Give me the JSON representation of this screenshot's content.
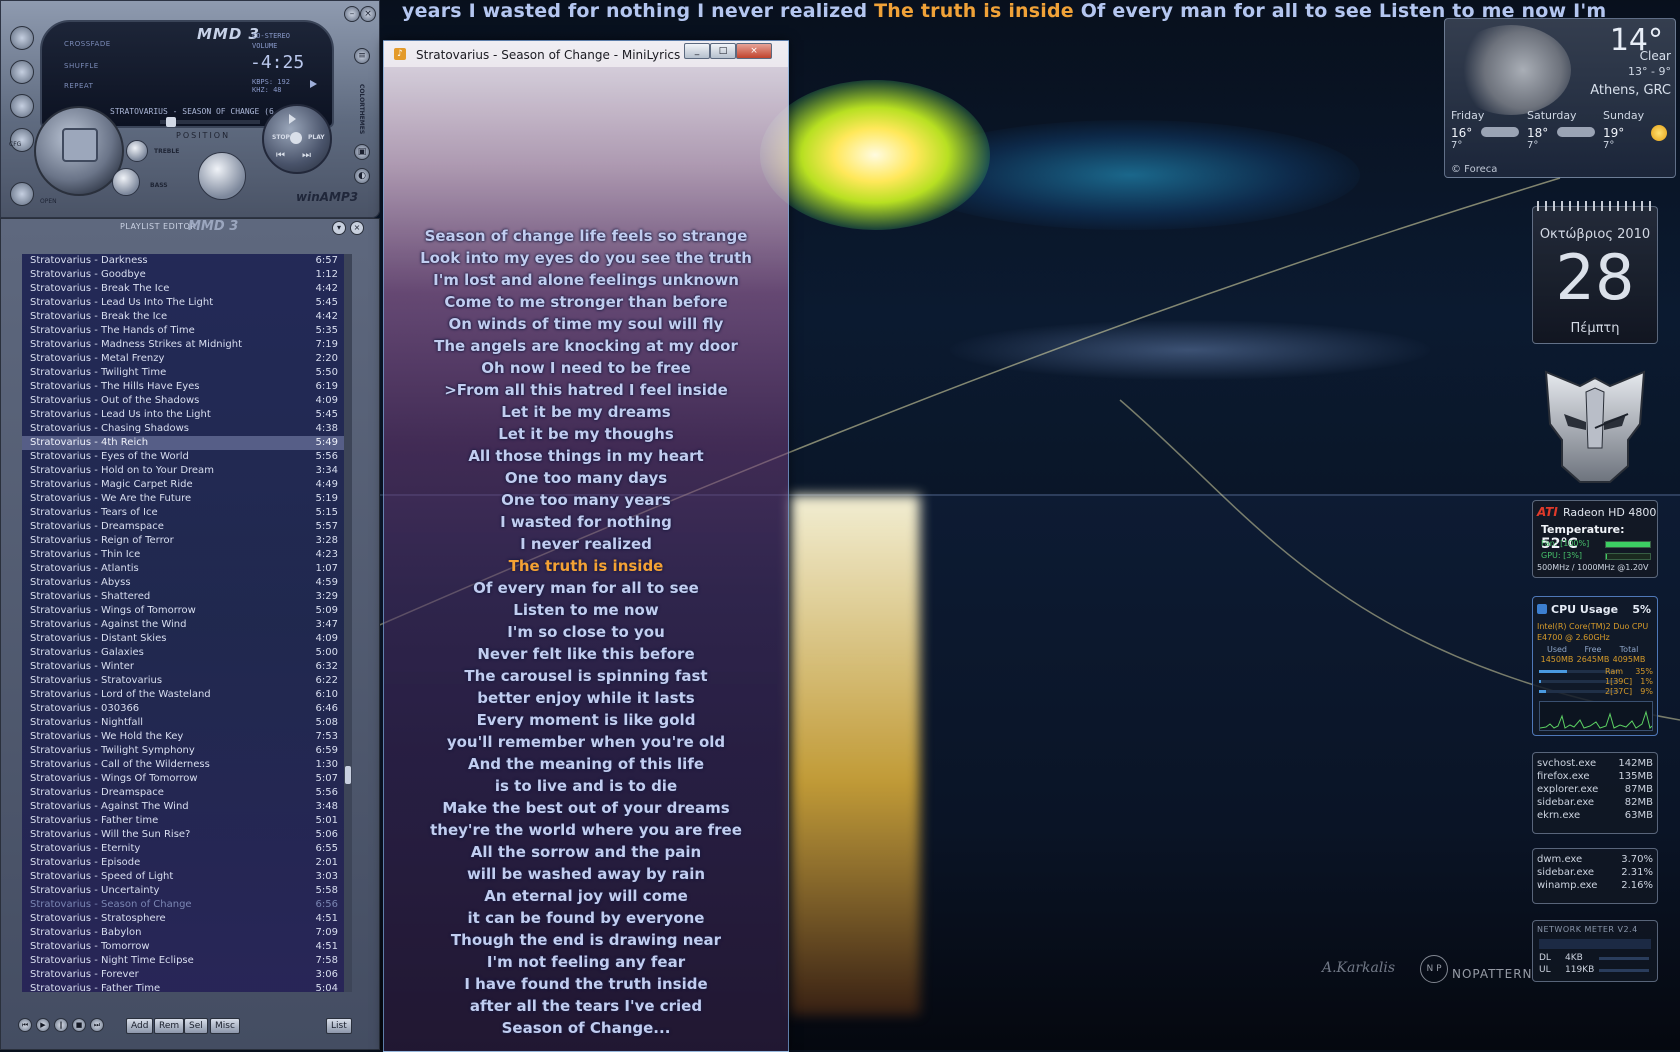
{
  "ticker": {
    "before": "years  I wasted for nothing  I never realized  ",
    "current": "The truth is inside",
    "after": "  Of every man for all to see  Listen to me now  I'm"
  },
  "winamp": {
    "logo": "MMD 3",
    "options": [
      "CROSSFADE",
      "SHUFFLE",
      "REPEAT"
    ],
    "stereo": "CO-STEREO",
    "volume": "VOLUME",
    "time": "-4:25",
    "kbps": "KBPS: 192",
    "khz": "KHZ: 48",
    "title": "STRATOVARIUS - SEASON OF CHANGE (6",
    "position_label": "POSITION",
    "stop_label": "STOP",
    "play_label": "PLAY",
    "treble_label": "TREBLE",
    "bass_label": "BASS",
    "open_label": "OPEN",
    "brand": "winAMP3",
    "colorthemes": "COLORTHEMES",
    "cfg": "CFG"
  },
  "playlist": {
    "title": "PLAYLIST EDITOR",
    "mmd": "MMD 3",
    "tracks": [
      {
        "name": "Stratovarius - Darkness",
        "time": "6:57"
      },
      {
        "name": "Stratovarius - Goodbye",
        "time": "1:12"
      },
      {
        "name": "Stratovarius - Break The Ice",
        "time": "4:42"
      },
      {
        "name": "Stratovarius - Lead Us Into The Light",
        "time": "5:45"
      },
      {
        "name": "Stratovarius - Break the Ice",
        "time": "4:42"
      },
      {
        "name": "Stratovarius - The Hands of Time",
        "time": "5:35"
      },
      {
        "name": "Stratovarius - Madness Strikes at Midnight",
        "time": "7:19"
      },
      {
        "name": "Stratovarius - Metal Frenzy",
        "time": "2:20"
      },
      {
        "name": "Stratovarius - Twilight Time",
        "time": "5:50"
      },
      {
        "name": "Stratovarius - The Hills Have Eyes",
        "time": "6:19"
      },
      {
        "name": "Stratovarius - Out of the Shadows",
        "time": "4:09"
      },
      {
        "name": "Stratovarius - Lead Us into the Light",
        "time": "5:45"
      },
      {
        "name": "Stratovarius - Chasing Shadows",
        "time": "4:38"
      },
      {
        "name": "Stratovarius - 4th Reich",
        "time": "5:49"
      },
      {
        "name": "Stratovarius - Eyes of the World",
        "time": "5:56"
      },
      {
        "name": "Stratovarius - Hold on to Your Dream",
        "time": "3:34"
      },
      {
        "name": "Stratovarius - Magic Carpet Ride",
        "time": "4:49"
      },
      {
        "name": "Stratovarius - We Are the Future",
        "time": "5:19"
      },
      {
        "name": "Stratovarius - Tears of Ice",
        "time": "5:15"
      },
      {
        "name": "Stratovarius - Dreamspace",
        "time": "5:57"
      },
      {
        "name": "Stratovarius - Reign of Terror",
        "time": "3:28"
      },
      {
        "name": "Stratovarius - Thin Ice",
        "time": "4:23"
      },
      {
        "name": "Stratovarius - Atlantis",
        "time": "1:07"
      },
      {
        "name": "Stratovarius - Abyss",
        "time": "4:59"
      },
      {
        "name": "Stratovarius - Shattered",
        "time": "3:29"
      },
      {
        "name": "Stratovarius - Wings of Tomorrow",
        "time": "5:09"
      },
      {
        "name": "Stratovarius - Against the Wind",
        "time": "3:47"
      },
      {
        "name": "Stratovarius - Distant Skies",
        "time": "4:09"
      },
      {
        "name": "Stratovarius - Galaxies",
        "time": "5:00"
      },
      {
        "name": "Stratovarius - Winter",
        "time": "6:32"
      },
      {
        "name": "Stratovarius - Stratovarius",
        "time": "6:22"
      },
      {
        "name": "Stratovarius - Lord of the Wasteland",
        "time": "6:10"
      },
      {
        "name": "Stratovarius - 030366",
        "time": "6:46"
      },
      {
        "name": "Stratovarius - Nightfall",
        "time": "5:08"
      },
      {
        "name": "Stratovarius - We Hold the Key",
        "time": "7:53"
      },
      {
        "name": "Stratovarius - Twilight Symphony",
        "time": "6:59"
      },
      {
        "name": "Stratovarius - Call of the Wilderness",
        "time": "1:30"
      },
      {
        "name": "Stratovarius - Wings Of Tomorrow",
        "time": "5:07"
      },
      {
        "name": "Stratovarius - Dreamspace",
        "time": "5:56"
      },
      {
        "name": "Stratovarius - Against The Wind",
        "time": "3:48"
      },
      {
        "name": "Stratovarius - Father time",
        "time": "5:01"
      },
      {
        "name": "Stratovarius - Will the Sun Rise?",
        "time": "5:06"
      },
      {
        "name": "Stratovarius - Eternity",
        "time": "6:55"
      },
      {
        "name": "Stratovarius - Episode",
        "time": "2:01"
      },
      {
        "name": "Stratovarius - Speed of Light",
        "time": "3:03"
      },
      {
        "name": "Stratovarius - Uncertainty",
        "time": "5:58"
      },
      {
        "name": "Stratovarius - Season of Change",
        "time": "6:56"
      },
      {
        "name": "Stratovarius - Stratosphere",
        "time": "4:51"
      },
      {
        "name": "Stratovarius - Babylon",
        "time": "7:09"
      },
      {
        "name": "Stratovarius - Tomorrow",
        "time": "4:51"
      },
      {
        "name": "Stratovarius - Night Time Eclipse",
        "time": "7:58"
      },
      {
        "name": "Stratovarius - Forever",
        "time": "3:06"
      },
      {
        "name": "Stratovarius - Father Time",
        "time": "5:04"
      }
    ],
    "selected_index": 13,
    "playing_index": 46,
    "buttons": {
      "add": "Add",
      "rem": "Rem",
      "sel": "Sel",
      "misc": "Misc",
      "list": "List"
    }
  },
  "minilyrics": {
    "title": "Stratovarius - Season of Change - MiniLyrics",
    "current_index": 15,
    "lines": [
      "Season of change life feels so strange",
      "Look into my eyes do you see the truth",
      "I'm lost and alone feelings unknown",
      "Come to me stronger than before",
      "On winds of time my soul will fly",
      "The angels are knocking at my door",
      "Oh now I need to be free",
      ">From all this hatred I feel inside",
      "Let it be my dreams",
      "Let it be my thoughs",
      "All those things in my heart",
      "One too many days",
      "One too many years",
      "I wasted for nothing",
      "I never realized",
      "The truth is inside",
      "Of every man for all to see",
      "Listen to me now",
      "I'm so close to you",
      "Never felt like this before",
      "The carousel is spinning fast",
      "better enjoy while it lasts",
      "Every moment is like gold",
      "you'll remember when you're old",
      "And the meaning of this life",
      "is to live and is to die",
      "Make the best out of your dreams",
      "they're the world where you are free",
      "All the sorrow and the pain",
      "will be washed away by rain",
      "An eternal joy will come",
      "it can be found by everyone",
      "Though the end is drawing near",
      "I'm not feeling any fear",
      "I have found the truth inside",
      "after all the tears I've cried",
      "Season of Change..."
    ]
  },
  "weather": {
    "temp": "14°",
    "condition": "Clear",
    "range": "13° - 9°",
    "city": "Athens, GRC",
    "days": [
      {
        "name": "Friday",
        "hi": "16°",
        "lo": "7°"
      },
      {
        "name": "Saturday",
        "hi": "18°",
        "lo": "7°"
      },
      {
        "name": "Sunday",
        "hi": "19°",
        "lo": "7°"
      }
    ],
    "credit": "© Foreca"
  },
  "calendar": {
    "month": "Οκτώβριος 2010",
    "day": "28",
    "weekday": "Πέμπτη"
  },
  "gpu": {
    "brand": "ATI",
    "name": "Radeon HD 4800",
    "temp_label": "Temperature:",
    "temp_value": "52°C",
    "fan_label": "Fan: [100%]",
    "fan_fraction": 1.0,
    "gpu_label": "GPU: [3%]",
    "gpu_fraction": 0.03,
    "clocks": "500MHz / 1000MHz @1.20V"
  },
  "cpu": {
    "title": "CPU Usage",
    "percent": "5%",
    "model1": "Intel(R) Core(TM)2 Duo CPU",
    "model2": "E4700 @ 2.60GHz",
    "mem_headers": [
      "Used",
      "Free",
      "Total"
    ],
    "mem_values": [
      "1450MB",
      "2645MB",
      "4095MB"
    ],
    "rows": [
      {
        "label": "Ram",
        "value": "35%",
        "fraction": 0.35
      },
      {
        "label": "1[39C]",
        "value": "1%",
        "fraction": 0.01
      },
      {
        "label": "2[37C]",
        "value": "9%",
        "fraction": 0.09
      }
    ]
  },
  "processes_mem": [
    {
      "name": "svchost.exe",
      "value": "142MB"
    },
    {
      "name": "firefox.exe",
      "value": "135MB"
    },
    {
      "name": "explorer.exe",
      "value": "87MB"
    },
    {
      "name": "sidebar.exe",
      "value": "82MB"
    },
    {
      "name": "ekrn.exe",
      "value": "63MB"
    }
  ],
  "processes_cpu": [
    {
      "name": "dwm.exe",
      "value": "3.70%"
    },
    {
      "name": "sidebar.exe",
      "value": "2.31%"
    },
    {
      "name": "winamp.exe",
      "value": "2.16%"
    }
  ],
  "network": {
    "title": "NETWORK METER V2.4",
    "dl_label": "DL",
    "dl_value": "4KB",
    "ul_label": "UL",
    "ul_value": "119KB"
  },
  "wallpaper": {
    "brand": "NOPATTERN"
  }
}
